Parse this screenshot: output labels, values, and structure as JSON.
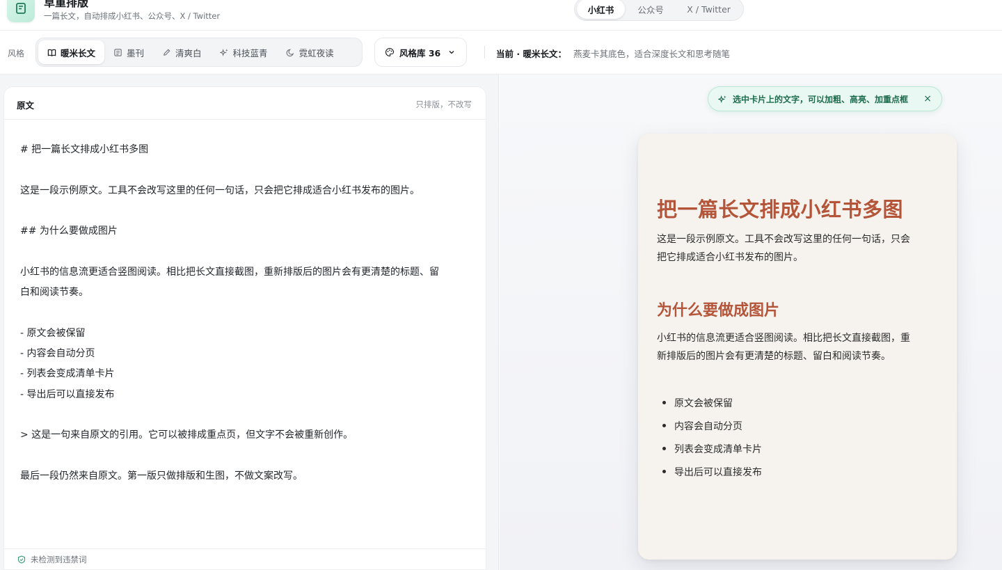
{
  "app": {
    "title": "草重排版",
    "subtitle": "一篇长文，自动排成小红书、公众号、X / Twitter"
  },
  "platforms": [
    {
      "label": "小红书",
      "active": true
    },
    {
      "label": "公众号",
      "active": false
    },
    {
      "label": "X / Twitter",
      "active": false
    }
  ],
  "toolbar": {
    "style_label": "风格",
    "styles": [
      {
        "label": "暖米长文",
        "icon": "book-open-icon",
        "active": true
      },
      {
        "label": "墨刊",
        "icon": "newspaper-icon",
        "active": false
      },
      {
        "label": "清爽白",
        "icon": "pen-icon",
        "active": false
      },
      {
        "label": "科技蓝青",
        "icon": "sparkles-icon",
        "active": false
      },
      {
        "label": "霓虹夜读",
        "icon": "moon-icon",
        "active": false
      }
    ],
    "library_label": "风格库 36",
    "current_label": "当前 · 暖米长文：",
    "current_desc": "燕麦卡其底色，适合深度长文和思考随笔"
  },
  "editor": {
    "title": "原文",
    "note": "只排版，不改写",
    "lines": [
      "# 把一篇长文排成小红书多图",
      "",
      "这是一段示例原文。工具不会改写这里的任何一句话，只会把它排成适合小红书发布的图片。",
      "",
      "## 为什么要做成图片",
      "",
      "小红书的信息流更适合竖图阅读。相比把长文直接截图，重新排版后的图片会有更清楚的标题、留",
      "白和阅读节奏。",
      "",
      "- 原文会被保留",
      "- 内容会自动分页",
      "- 列表会变成清单卡片",
      "- 导出后可以直接发布",
      "",
      "> 这是一句来自原文的引用。它可以被排成重点页，但文字不会被重新创作。",
      "",
      "最后一段仍然来自原文。第一版只做排版和生图，不做文案改写。"
    ],
    "status": "未检测到违禁词"
  },
  "preview": {
    "hint": "选中卡片上的文字，可以加粗、高亮、加重点框",
    "hint_close": "×",
    "card": {
      "h1": "把一篇长文排成小红书多图",
      "p1_line1": "这是一段示例原文。工具不会改写这里的任何一句话，只会",
      "p1_line2": "把它排成适合小红书发布的图片。",
      "h2": "为什么要做成图片",
      "p2_line1": "小红书的信息流更适合竖图阅读。相比把长文直接截图，重",
      "p2_line2": "新排版后的图片会有更清楚的标题、留白和阅读节奏。",
      "list": [
        "原文会被保留",
        "内容会自动分页",
        "列表会变成清单卡片",
        "导出后可以直接发布"
      ]
    }
  },
  "colors": {
    "accent_heading": "#b4553a",
    "card_bg": "#f6f3ee",
    "hint_bg": "#e9f8f2",
    "hint_text": "#1d6b4f"
  }
}
